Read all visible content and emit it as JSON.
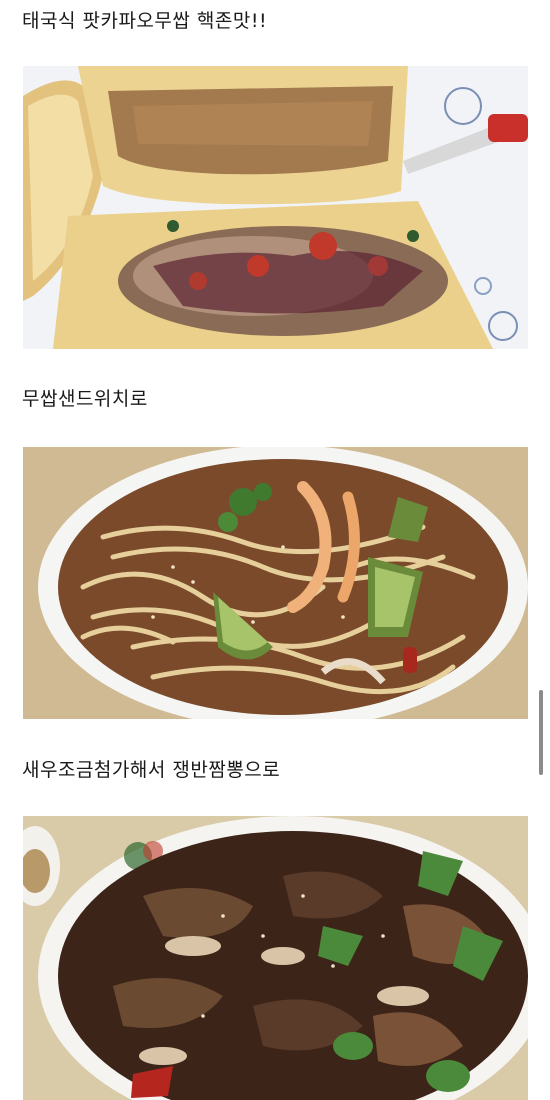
{
  "post": {
    "caption_1": "태국식 팟카파오무쌉  핵존맛!!",
    "caption_2": "무쌉샌드위치로",
    "caption_3": "새우조금첨가해서 쟁반짬뽕으로"
  },
  "photos": [
    {
      "subject": "bread-with-pad-kra-pao"
    },
    {
      "subject": "stir-fried-noodles-with-shrimp"
    },
    {
      "subject": "jjambbong-stir-fry"
    }
  ]
}
